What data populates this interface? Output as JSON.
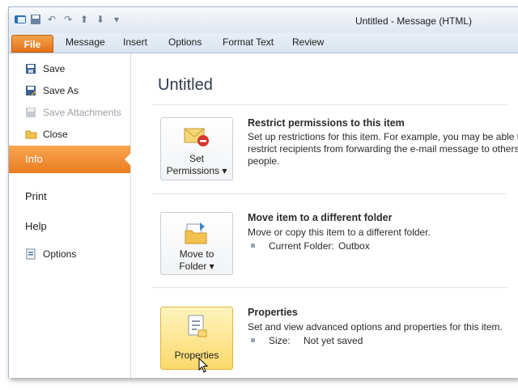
{
  "window_title": "Untitled  -  Message (HTML)",
  "tabs": [
    "File",
    "Message",
    "Insert",
    "Options",
    "Format Text",
    "Review"
  ],
  "sidebar": {
    "save": "Save",
    "save_as": "Save As",
    "save_attachments": "Save Attachments",
    "close": "Close",
    "info": "Info",
    "print": "Print",
    "help": "Help",
    "options": "Options"
  },
  "main": {
    "title": "Untitled",
    "permissions": {
      "button_line1": "Set",
      "button_line2": "Permissions ▾",
      "heading": "Restrict permissions to this item",
      "line1": "Set up restrictions for this item. For example, you may be able to",
      "line2": "restrict recipients from forwarding the e-mail message to others.",
      "line3": "people."
    },
    "move": {
      "button_line1": "Move to",
      "button_line2": "Folder ▾",
      "heading": "Move item to a different folder",
      "line1": "Move or copy this item to a different folder.",
      "folder_label": "Current Folder:",
      "folder_value": "Outbox"
    },
    "properties": {
      "button_label": "Properties",
      "heading": "Properties",
      "line1": "Set and view advanced options and properties for this item.",
      "size_label": "Size:",
      "size_value": "Not yet saved"
    }
  },
  "colors": {
    "file_tab": "#e2711a",
    "selection": "#f9a550"
  }
}
